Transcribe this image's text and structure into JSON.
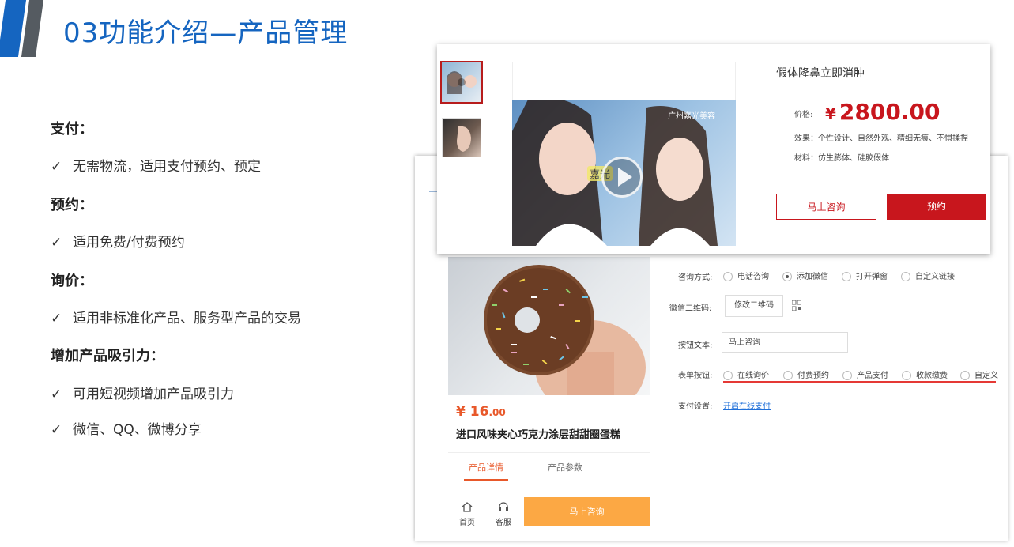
{
  "slide": {
    "title": "03功能介绍—产品管理"
  },
  "features": [
    {
      "title": "支付：",
      "bullets": [
        "无需物流，适用支付预约、预定"
      ]
    },
    {
      "title": "预约：",
      "bullets": [
        "适用免费/付费预约"
      ]
    },
    {
      "title": "询价：",
      "bullets": [
        "适用非标准化产品、服务型产品的交易"
      ]
    },
    {
      "title": "增加产品吸引力：",
      "bullets": [
        "可用短视频增加产品吸引力",
        "微信、QQ、微博分享"
      ]
    }
  ],
  "check_glyph": "✓",
  "product_page": {
    "price_symbol": "¥",
    "price_int": "16",
    "price_dec": ".00",
    "name": "进口风味夹心巧克力涂层甜甜圈蛋糕",
    "tabs": [
      "产品详情",
      "产品参数"
    ],
    "nav": [
      {
        "label": "首页",
        "icon": "home-icon"
      },
      {
        "label": "客服",
        "icon": "headset-icon"
      }
    ],
    "consult_button": "马上咨询"
  },
  "settings_form": {
    "consult_method_label": "咨询方式:",
    "consult_options": [
      {
        "label": "电话咨询",
        "checked": false
      },
      {
        "label": "添加微信",
        "checked": true
      },
      {
        "label": "打开弹窗",
        "checked": false
      },
      {
        "label": "自定义链接",
        "checked": false
      }
    ],
    "qr_label": "微信二维码:",
    "qr_button": "修改二维码",
    "button_text_label": "按钮文本:",
    "button_text_value": "马上咨询",
    "form_button_label": "表单按钮:",
    "form_button_options": [
      "在线询价",
      "付费预约",
      "产品支付",
      "收款缴费",
      "自定义"
    ],
    "payment_label": "支付设置:",
    "payment_link": "开启在线支付"
  },
  "detail_card": {
    "title": "假体隆鼻立即消肿",
    "price_label": "价格:",
    "price_symbol": "¥",
    "price": "2800.00",
    "effect": "效果：个性设计、自然外观、精细无痕、不惧揉捏",
    "material": "材料：仿生膨体、硅胶假体",
    "watermark": "广州嘉光美容",
    "video_caption": "嘉光",
    "consult_button": "马上咨询",
    "book_button": "预约"
  },
  "colors": {
    "brand_blue": "#1565c0",
    "accent_red": "#c8161d",
    "accent_orange": "#e8582a",
    "button_orange": "#fca844"
  }
}
